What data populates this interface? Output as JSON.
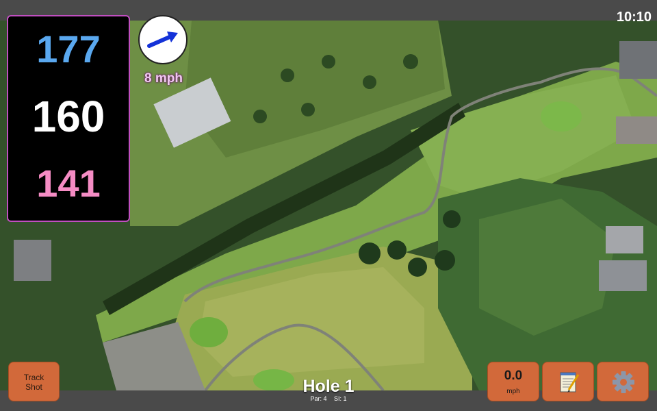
{
  "status_bar": {
    "time": "10:10"
  },
  "yardages": {
    "back": "177",
    "center": "160",
    "front": "141"
  },
  "wind": {
    "speed_label": "8 mph",
    "icon": "wind-direction-arrow-icon"
  },
  "buttons": {
    "track_shot_line1": "Track",
    "track_shot_line2": "Shot",
    "speed_value": "0.0",
    "speed_unit": "mph",
    "notes_icon": "notepad-icon",
    "settings_icon": "gear-icon"
  },
  "hole": {
    "title": "Hole 1",
    "par": "Par: 4",
    "si": "SI: 1"
  },
  "colors": {
    "back_yardage": "#5aa8ef",
    "center_yardage": "#ffffff",
    "front_yardage": "#f58cc4",
    "button": "#d2693a"
  }
}
